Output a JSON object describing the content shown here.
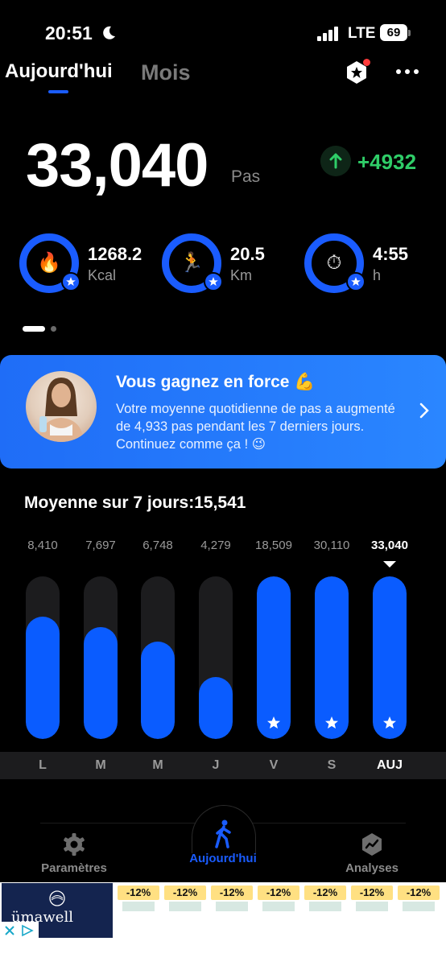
{
  "status_bar": {
    "time": "20:51",
    "network": "LTE",
    "battery": "69"
  },
  "header": {
    "tabs": [
      {
        "label": "Aujourd'hui",
        "active": true
      },
      {
        "label": "Mois",
        "active": false
      }
    ]
  },
  "summary": {
    "steps": "33,040",
    "steps_unit": "Pas",
    "delta": "+4932"
  },
  "metrics": [
    {
      "value": "1268.2",
      "unit": "Kcal",
      "icon": "fire-icon"
    },
    {
      "value": "20.5",
      "unit": "Km",
      "icon": "runner-icon"
    },
    {
      "value": "4:55",
      "unit": "h",
      "icon": "stopwatch-icon"
    }
  ],
  "banner": {
    "title": "Vous gagnez en force 💪",
    "text": "Votre moyenne quotidienne de pas a augmenté de 4,933 pas pendant les 7 derniers jours. Continuez comme ça ! 😉"
  },
  "weekly": {
    "average_label": "Moyenne sur 7 jours:15,541",
    "days": [
      {
        "day": "L",
        "value": "8,410",
        "steps": 8410,
        "fill": 0.75,
        "goal": false,
        "today": false
      },
      {
        "day": "M",
        "value": "7,697",
        "steps": 7697,
        "fill": 0.69,
        "goal": false,
        "today": false
      },
      {
        "day": "M",
        "value": "6,748",
        "steps": 6748,
        "fill": 0.6,
        "goal": false,
        "today": false
      },
      {
        "day": "J",
        "value": "4,279",
        "steps": 4279,
        "fill": 0.38,
        "goal": false,
        "today": false
      },
      {
        "day": "V",
        "value": "18,509",
        "steps": 18509,
        "fill": 1.0,
        "goal": true,
        "today": false
      },
      {
        "day": "S",
        "value": "30,110",
        "steps": 30110,
        "fill": 1.0,
        "goal": true,
        "today": false
      },
      {
        "day": "AUJ",
        "value": "33,040",
        "steps": 33040,
        "fill": 1.0,
        "goal": true,
        "today": true
      }
    ]
  },
  "bottom_nav": [
    {
      "label": "Paramètres",
      "icon": "gear-icon",
      "active": false
    },
    {
      "label": "Aujourd'hui",
      "icon": "walking-person-icon",
      "active": true
    },
    {
      "label": "Analyses",
      "icon": "analytics-icon",
      "active": false
    }
  ],
  "ad": {
    "brand": "ümawell",
    "deals": [
      "-12%",
      "-12%",
      "-12%",
      "-12%",
      "-12%",
      "-12%",
      "-12%"
    ]
  },
  "colors": {
    "accent": "#1a5cff",
    "positive": "#2fcd68",
    "track": "#1c1c1e"
  }
}
